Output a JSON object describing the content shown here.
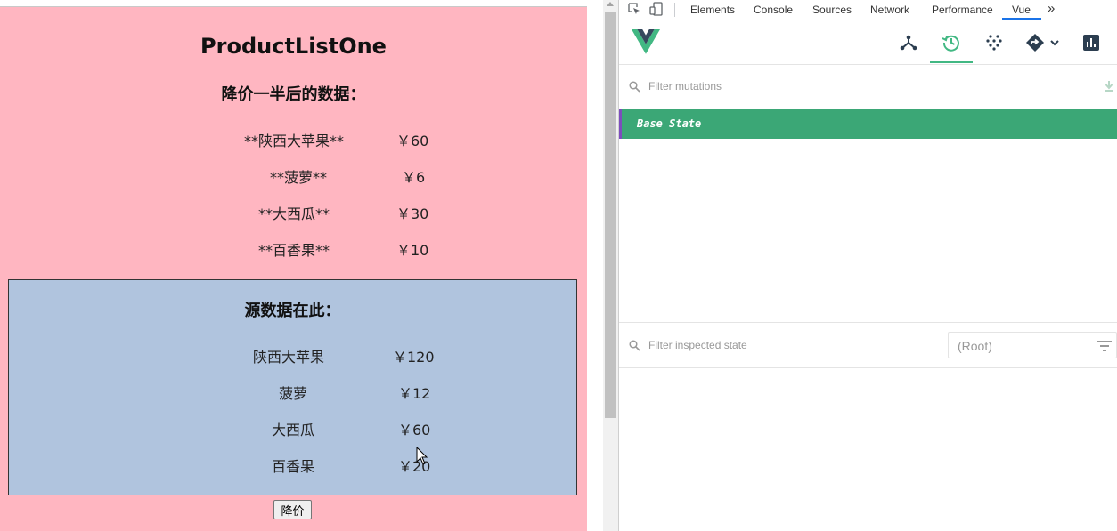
{
  "app": {
    "title": "ProductListOne",
    "discount_heading": "降价一半后的数据：",
    "discounted_products": [
      {
        "name": "**陕西大苹果**",
        "price": "￥60"
      },
      {
        "name": "**菠萝**",
        "price": "￥6"
      },
      {
        "name": "**大西瓜**",
        "price": "￥30"
      },
      {
        "name": "**百香果**",
        "price": "￥10"
      }
    ],
    "source_heading": "源数据在此：",
    "source_products": [
      {
        "name": "陕西大苹果",
        "price": "￥120"
      },
      {
        "name": "菠萝",
        "price": "￥12"
      },
      {
        "name": "大西瓜",
        "price": "￥60"
      },
      {
        "name": "百香果",
        "price": "￥20"
      }
    ],
    "reduce_button": "降价"
  },
  "devtools": {
    "tabs": [
      "Elements",
      "Console",
      "Sources",
      "Network",
      "Performance",
      "Vue"
    ],
    "active_tab": "Vue",
    "more_tabs": "»",
    "mutation_filter_placeholder": "Filter mutations",
    "base_state": "Base State",
    "state_filter_placeholder": "Filter inspected state",
    "root_select": "(Root)"
  },
  "colors": {
    "app_bg": "#ffb6c1",
    "source_bg": "#b0c4de",
    "vue_green": "#42b883",
    "base_state_bg": "#3ba776",
    "devtools_tab_accent": "#1a73e8"
  },
  "icons": [
    "inspect-element-icon",
    "device-toolbar-icon",
    "vue-logo",
    "components-icon",
    "history-icon",
    "events-icon",
    "router-icon",
    "chevron-down-icon",
    "performance-icon",
    "search-icon",
    "download-icon",
    "filter-list-icon",
    "mouse-cursor-icon"
  ]
}
